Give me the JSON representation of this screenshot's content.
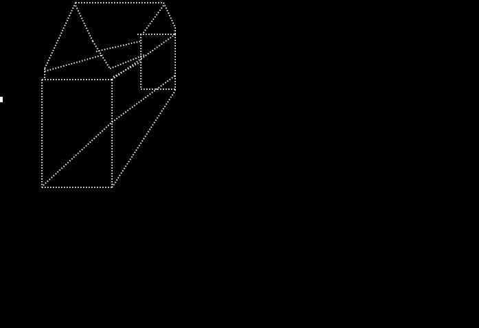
{
  "canvas": {
    "background": "#000000",
    "dot_color": "#ffffff"
  },
  "drawing": {
    "subject": "dotted-wireframe-carton",
    "cursor_visible": true
  }
}
